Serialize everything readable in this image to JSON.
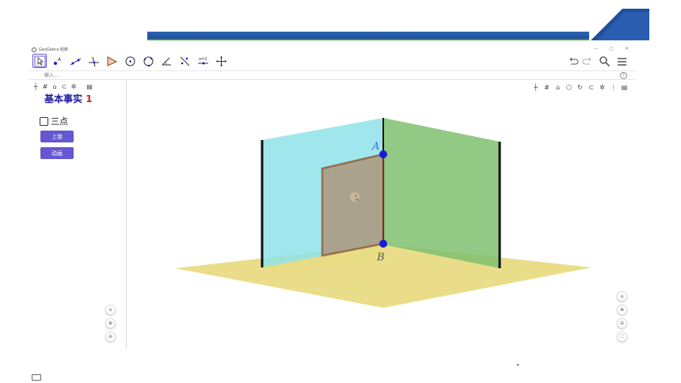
{
  "app": {
    "title": "GeoGebra 经典",
    "window_controls": [
      "—",
      "▢",
      "✕"
    ]
  },
  "toolbar": {
    "tools": [
      "move-tool",
      "point-tool",
      "line-tool",
      "perpendicular-tool",
      "polygon-tool",
      "circle-tool",
      "circle-3pt-tool",
      "angle-tool",
      "reflect-tool",
      "slider-tool",
      "move-view-tool"
    ],
    "right": [
      "undo",
      "redo",
      "search",
      "menu"
    ]
  },
  "input_bar": {
    "placeholder": "输入..."
  },
  "left_panel": {
    "heading_main": "基本事实",
    "heading_red": "1",
    "checkbox_label": "三点",
    "buttons": {
      "lock": "上锁",
      "animate": "动画"
    }
  },
  "view3d": {
    "point_a": "A",
    "point_b": "B"
  },
  "colors": {
    "accent": "#6557d2",
    "plane_floor": "#e8d97c",
    "plane_left": "#8ee3ea",
    "plane_right": "#7fbf6e",
    "door": "#8a4a1e",
    "point": "#1a1ad8"
  }
}
